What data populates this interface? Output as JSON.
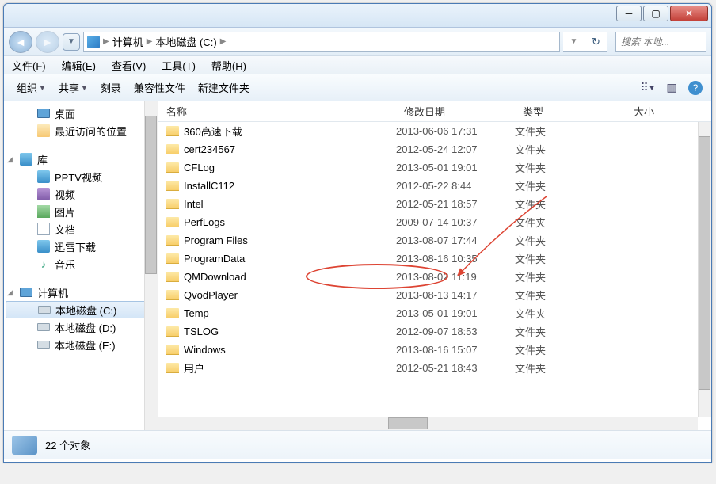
{
  "nav": {
    "crumb1": "计算机",
    "crumb2": "本地磁盘 (C:)"
  },
  "search": {
    "placeholder": "搜索 本地..."
  },
  "menu": {
    "file": "文件(F)",
    "edit": "编辑(E)",
    "view": "查看(V)",
    "tools": "工具(T)",
    "help": "帮助(H)"
  },
  "toolbar": {
    "organize": "组织",
    "share": "共享",
    "burn": "刻录",
    "compat": "兼容性文件",
    "newfolder": "新建文件夹"
  },
  "sidebar": {
    "desktop": "桌面",
    "recent": "最近访问的位置",
    "libraries": "库",
    "pptv": "PPTV视频",
    "videos": "视频",
    "pictures": "图片",
    "documents": "文档",
    "xunlei": "迅雷下载",
    "music": "音乐",
    "computer": "计算机",
    "drivec": "本地磁盘 (C:)",
    "drived": "本地磁盘 (D:)",
    "drivee": "本地磁盘 (E:)"
  },
  "columns": {
    "name": "名称",
    "date": "修改日期",
    "type": "类型",
    "size": "大小"
  },
  "type_folder": "文件夹",
  "files": [
    {
      "name": "360高速下载",
      "date": "2013-06-06 17:31"
    },
    {
      "name": "cert234567",
      "date": "2012-05-24 12:07"
    },
    {
      "name": "CFLog",
      "date": "2013-05-01 19:01"
    },
    {
      "name": "InstallC112",
      "date": "2012-05-22 8:44"
    },
    {
      "name": "Intel",
      "date": "2012-05-21 18:57"
    },
    {
      "name": "PerfLogs",
      "date": "2009-07-14 10:37"
    },
    {
      "name": "Program Files",
      "date": "2013-08-07 17:44"
    },
    {
      "name": "ProgramData",
      "date": "2013-08-16 10:35"
    },
    {
      "name": "QMDownload",
      "date": "2013-08-02 11:19"
    },
    {
      "name": "QvodPlayer",
      "date": "2013-08-13 14:17"
    },
    {
      "name": "Temp",
      "date": "2013-05-01 19:01"
    },
    {
      "name": "TSLOG",
      "date": "2012-09-07 18:53"
    },
    {
      "name": "Windows",
      "date": "2013-08-16 15:07"
    },
    {
      "name": "用户",
      "date": "2012-05-21 18:43"
    }
  ],
  "status": {
    "count": "22 个对象"
  }
}
